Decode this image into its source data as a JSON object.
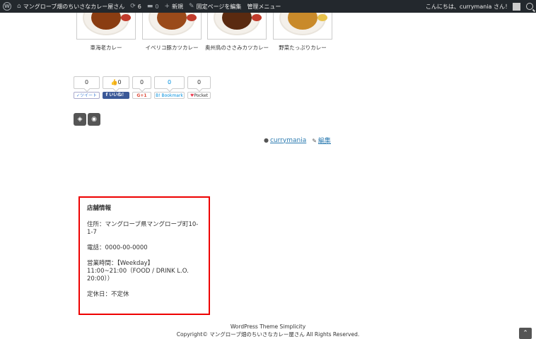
{
  "adminbar": {
    "site_name": "マングローブ畑のちいさなカレー屋さん",
    "updates_count": "6",
    "comments_count": "0",
    "new_label": "新規",
    "edit_page_label": "固定ページを編集",
    "admin_menu_label": "管理メニュー",
    "greeting": "こんにちは、currymania さん！"
  },
  "related": [
    {
      "label": "車海老カレー",
      "food_color": "#8a3d12"
    },
    {
      "label": "イベリコ豚カツカレー",
      "food_color": "#9a4a1a"
    },
    {
      "label": "奥州鳥のささみカツカレー",
      "food_color": "#5a2a10"
    },
    {
      "label": "野菜たっぷりカレー",
      "food_color": "#c98a2a"
    }
  ],
  "share": {
    "twitter": {
      "count": "0",
      "label": "ツイート"
    },
    "facebook": {
      "count": "0",
      "label": "いいね！"
    },
    "googleplus": {
      "count": "0",
      "label": "G+1"
    },
    "hatena": {
      "count": "0",
      "label": "Bookmark"
    },
    "pocket": {
      "count": "0",
      "label": "Pocket"
    }
  },
  "meta": {
    "author": "currymania",
    "edit": "編集"
  },
  "store": {
    "title": "店舗情報",
    "address": "住所：マングローブ県マングローブ町10-1-7",
    "phone": "電話：0000-00-0000",
    "hours": "営業時間：【Weekday】\n11:00~21:00（FOOD / DRINK L.O. 20:00））",
    "holiday": "定休日：不定休"
  },
  "footer": {
    "theme": "WordPress Theme Simplicity",
    "copyright": "Copyright© マングローブ畑のちいさなカレー屋さん All Rights Reserved."
  },
  "colors": {
    "adminbar_bg": "#23282d",
    "store_border": "#ee0000",
    "link": "#2a7ab0"
  }
}
